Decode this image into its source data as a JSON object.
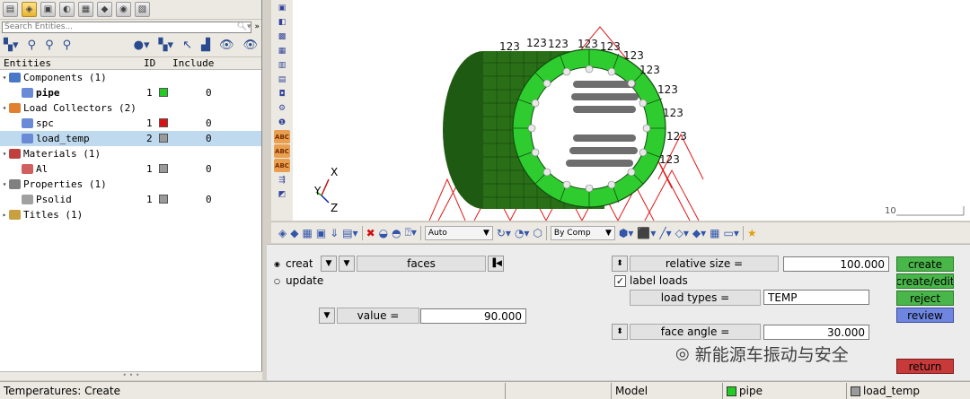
{
  "search": {
    "placeholder": "Search Entities..."
  },
  "table_header": {
    "entities": "Entities",
    "id": "ID",
    "include": "Include"
  },
  "tree": {
    "components": {
      "label": "Components (1)"
    },
    "pipe": {
      "label": "pipe",
      "id": "1",
      "include": "0",
      "color": "#22cc22"
    },
    "load_collectors": {
      "label": "Load Collectors (2)"
    },
    "spc": {
      "label": "spc",
      "id": "1",
      "include": "0",
      "color": "#dd1111"
    },
    "load_temp": {
      "label": "load_temp",
      "id": "2",
      "include": "0",
      "color": "#9a9a9a"
    },
    "materials": {
      "label": "Materials (1)"
    },
    "al": {
      "label": "Al",
      "id": "1",
      "include": "0",
      "color": "#9a9a9a"
    },
    "properties": {
      "label": "Properties (1)"
    },
    "psolid": {
      "label": "Psolid",
      "id": "1",
      "include": "0",
      "color": "#9a9a9a"
    },
    "titles": {
      "label": "Titles (1)"
    }
  },
  "graphics": {
    "label_value": "123",
    "axis_x": "X",
    "axis_y": "Y",
    "axis_z": "Z",
    "scale_value": "10"
  },
  "htoolbar": {
    "auto_label": "Auto",
    "bycomp_label": "By Comp"
  },
  "panel": {
    "create_radio": "create",
    "update_radio": "update",
    "faces_label": "faces",
    "value_label": "value =",
    "value": "90.000",
    "relative_size_label": "relative size =",
    "relative_size": "100.000",
    "label_loads": "label loads",
    "load_types_label": "load types =",
    "load_types": "TEMP",
    "face_angle_label": "face angle =",
    "face_angle": "30.000",
    "btn_create": "create",
    "btn_create_edit": "create/edit",
    "btn_reject": "reject",
    "btn_review": "review",
    "btn_return": "return",
    "watermark": "新能源车振动与安全"
  },
  "status": {
    "left": "Temperatures: Create",
    "model": "Model",
    "comp": "pipe",
    "comp_color": "#22cc22",
    "loadcol": "load_temp",
    "loadcol_color": "#9a9a9a"
  }
}
